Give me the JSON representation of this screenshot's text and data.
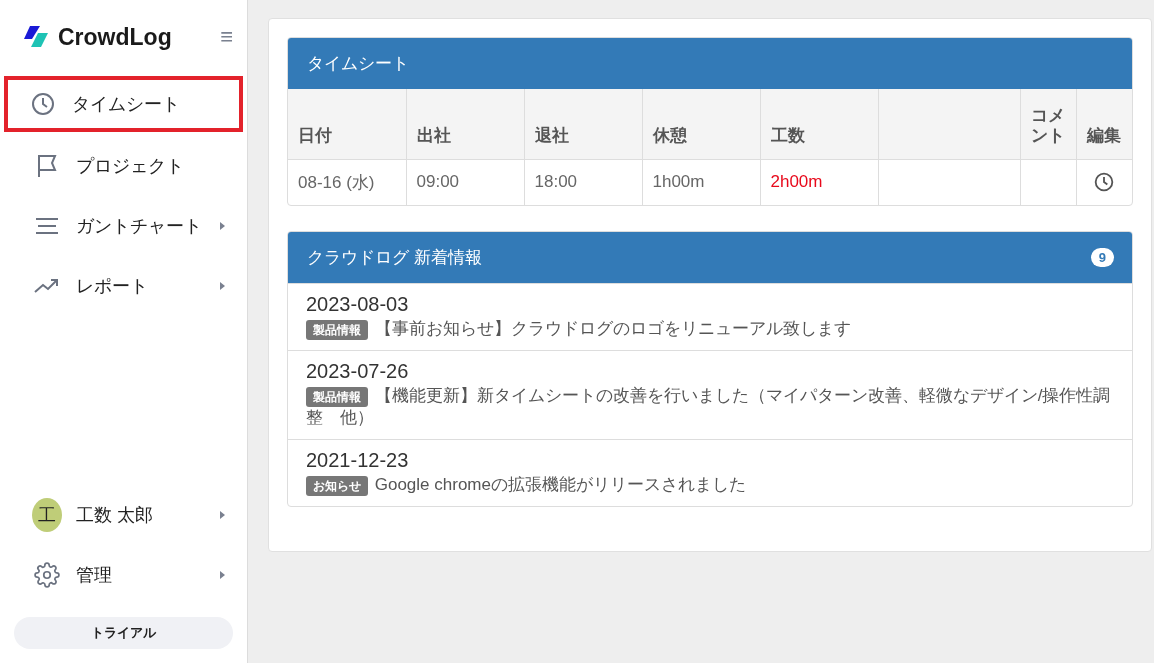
{
  "sidebar": {
    "logo": "CrowdLog",
    "menu_icon": "≡",
    "items": [
      {
        "kind": "clock",
        "label": "タイムシート",
        "highlighted": true,
        "submenu": false
      },
      {
        "kind": "flag",
        "label": "プロジェクト",
        "highlighted": false,
        "submenu": false
      },
      {
        "kind": "lines",
        "label": "ガントチャート",
        "highlighted": false,
        "submenu": true
      },
      {
        "kind": "trend",
        "label": "レポート",
        "highlighted": false,
        "submenu": true
      }
    ],
    "bottom_items": [
      {
        "kind": "avatar",
        "avatar_text": "工",
        "label": "工数 太郎",
        "submenu": true
      },
      {
        "kind": "gear",
        "label": "管理",
        "submenu": true
      }
    ],
    "plan_badge": "トライアル"
  },
  "timesheet": {
    "title": "タイムシート",
    "columns": [
      {
        "label": "日付"
      },
      {
        "label": "出社"
      },
      {
        "label": "退社"
      },
      {
        "label": "休憩"
      },
      {
        "label": "工数"
      },
      {},
      {
        "label": "コメント"
      },
      {
        "label": "編集"
      }
    ],
    "rows": [
      {
        "cells": [
          {
            "kind": "text",
            "text": "08-16 (水)",
            "alert": false
          },
          {
            "kind": "text",
            "text": "09:00",
            "alert": false
          },
          {
            "kind": "text",
            "text": "18:00",
            "alert": false
          },
          {
            "kind": "text",
            "text": "1h00m",
            "alert": false
          },
          {
            "kind": "text",
            "text": "2h00m",
            "alert": true
          },
          {
            "kind": "empty"
          },
          {
            "kind": "empty"
          },
          {
            "kind": "edit"
          }
        ]
      }
    ]
  },
  "news": {
    "title": "クラウドログ 新着情報",
    "count": "9",
    "items": [
      {
        "date": "2023-08-03",
        "tag": "製品情報",
        "text": "【事前お知らせ】クラウドログのロゴをリニューアル致します"
      },
      {
        "date": "2023-07-26",
        "tag": "製品情報",
        "text": "【機能更新】新タイムシートの改善を行いました（マイパターン改善、軽微なデザイン/操作性調整　他）"
      },
      {
        "date": "2021-12-23",
        "tag": "お知らせ",
        "text": "Google chromeの拡張機能がリリースされました"
      }
    ]
  }
}
